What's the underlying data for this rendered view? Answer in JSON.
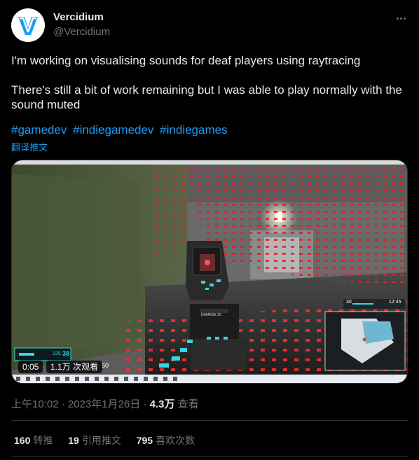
{
  "author": {
    "name": "Vercidium",
    "handle": "@Vercidium",
    "avatar_icon": "vercidium-logo-icon",
    "brand_color": "#1d9bf0"
  },
  "menu": {
    "icon": "more-horizontal-icon"
  },
  "tweet": {
    "paragraphs": [
      "I'm working on visualising sounds for deaf players using raytracing",
      "There's still a bit of work remaining but I was able to play normally with the sound muted"
    ],
    "hashtags": [
      "#gamedev",
      "#indiegamedev",
      "#indiegames"
    ],
    "translate_label": "翻译推文"
  },
  "video": {
    "elapsed": "0:05",
    "views": "1.1万 次观看",
    "hud": {
      "ammo_loaded": "38",
      "ammo_reserve": "225",
      "health": "50",
      "speed": "30",
      "clock": "12:45",
      "crosshair_label": "DAMAGE",
      "crosshair_value": "35"
    }
  },
  "meta": {
    "time": "上午10:02",
    "separator": "·",
    "date": "2023年1月26日",
    "views_count": "4.3万",
    "views_label": "查看"
  },
  "stats": {
    "retweets_count": "160",
    "retweets_label": "转推",
    "quotes_count": "19",
    "quotes_label": "引用推文",
    "likes_count": "795",
    "likes_label": "喜欢次数"
  },
  "colors": {
    "background": "#000000",
    "text": "#e7e9ea",
    "muted": "#71767b",
    "link": "#1d9bf0",
    "divider": "#2f3336",
    "sound_dots": "#e0202a",
    "hud_cyan": "#35d6e8"
  }
}
